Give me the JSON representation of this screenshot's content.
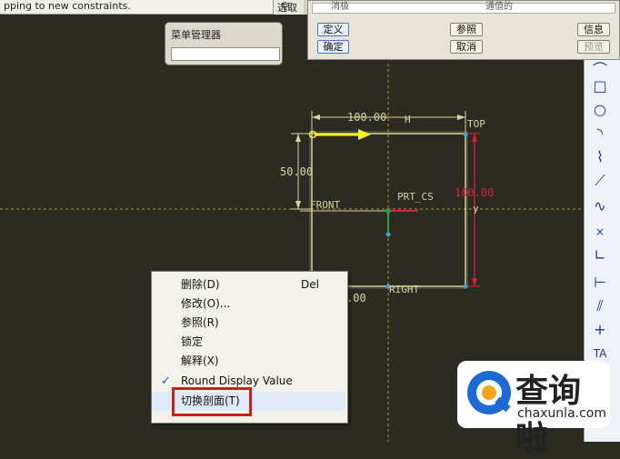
{
  "status_bar": {
    "message": "pping to new constraints.",
    "icon": "shovel-icon",
    "right_text": "选取"
  },
  "constraint_dialog": {
    "buttons": {
      "define": "定义",
      "ok": "确定",
      "reference": "参照",
      "cancel": "取消",
      "info": "信息",
      "preview": "预览"
    },
    "top_partial": [
      "消极",
      "通值的"
    ]
  },
  "menu_manager": {
    "title": "菜单管理器"
  },
  "sketch": {
    "dim_horizontal": "100.00",
    "dim_h_label": "H",
    "dim_vertical": "50.00",
    "dim_vertical_right": "100.00",
    "dim_bottom": ".00",
    "label_top": "TOP",
    "label_front": "FRONT",
    "label_right": "RIGHT",
    "label_csys": "PRT_CS",
    "label_y": "y"
  },
  "context_menu": {
    "items": [
      {
        "label": "删除(D)",
        "accel": "Del"
      },
      {
        "label": "修改(O)...",
        "accel": ""
      },
      {
        "label": "参照(R)",
        "accel": ""
      },
      {
        "label": "锁定",
        "accel": ""
      },
      {
        "label": "解释(X)",
        "accel": ""
      },
      {
        "label": "Round Display Value",
        "accel": "",
        "checked": true
      },
      {
        "label": "切换剖面(T)",
        "accel": "",
        "highlighted": true
      }
    ]
  },
  "toolbar_icons": [
    "arc-icon",
    "rectangle-icon",
    "circle-icon",
    "arc-icon",
    "point-icon",
    "fillet-icon",
    "spline-icon",
    "cross-icon",
    "corner-icon",
    "dimension-icon",
    "modify-icon",
    "constraint-icon",
    "text-icon",
    "palette-icon"
  ],
  "watermark": {
    "brand": "查询啦",
    "url": "chaxunla.com"
  },
  "colors": {
    "background": "#2b2b22",
    "sketch_line": "#d9d2a0",
    "dimension_red": "#d4203a",
    "highlight_red": "#d21b1b",
    "arrow_yellow": "#f5f02a"
  }
}
